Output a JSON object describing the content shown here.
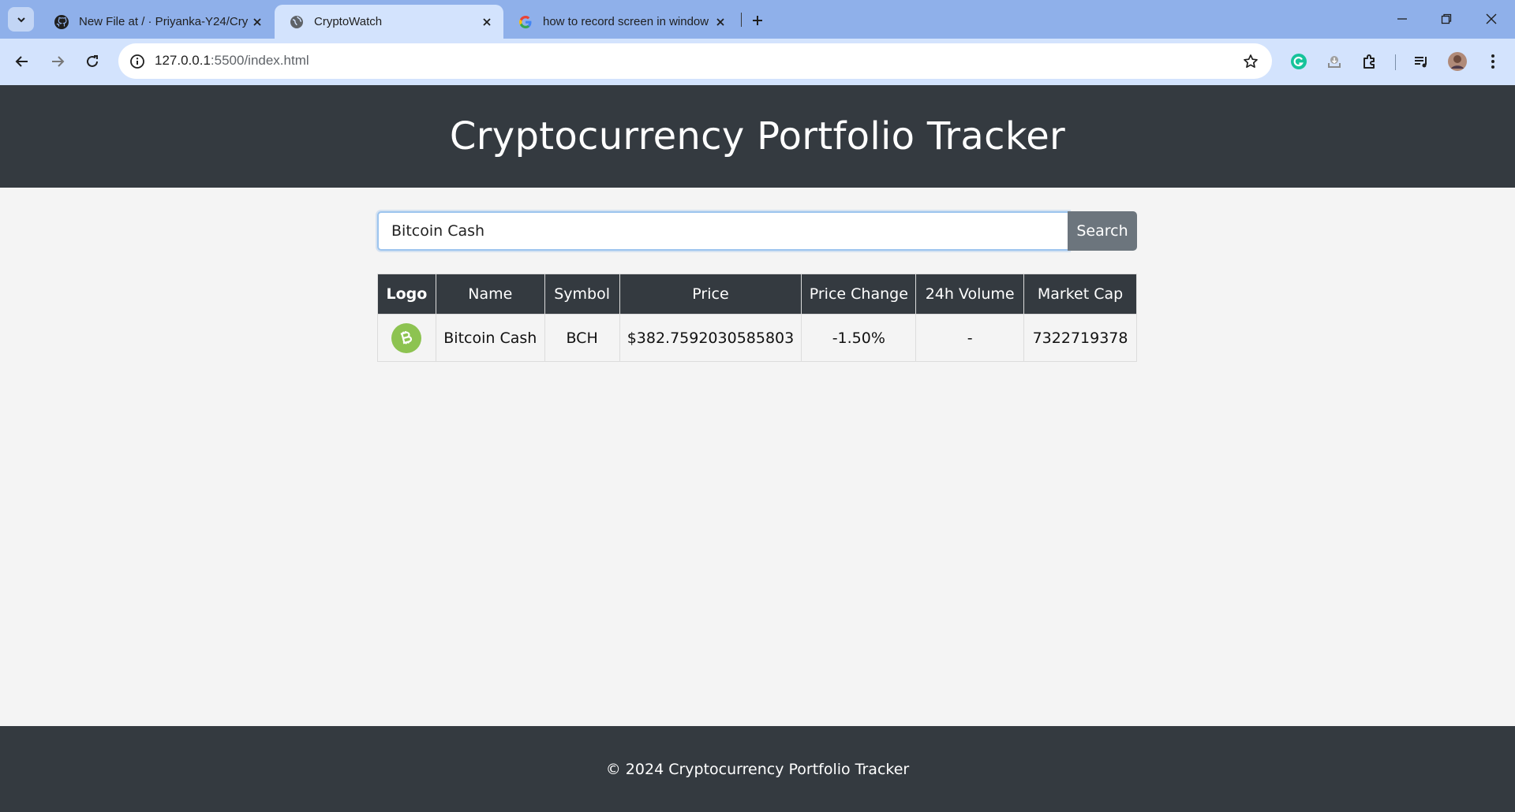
{
  "browser": {
    "tabs": [
      {
        "title": "New File at / · Priyanka-Y24/Cry",
        "favicon": "github-icon",
        "active": false
      },
      {
        "title": "CryptoWatch",
        "favicon": "globe-icon",
        "active": true
      },
      {
        "title": "how to record screen in window",
        "favicon": "google-icon",
        "active": false
      }
    ],
    "url_host": "127.0.0.1",
    "url_rest": ":5500/index.html"
  },
  "page": {
    "title": "Cryptocurrency Portfolio Tracker",
    "search": {
      "value": "Bitcoin Cash",
      "button_label": "Search"
    },
    "table": {
      "headers": [
        "Logo",
        "Name",
        "Symbol",
        "Price",
        "Price Change",
        "24h Volume",
        "Market Cap"
      ],
      "rows": [
        {
          "logo": "bitcoin-cash-logo",
          "name": "Bitcoin Cash",
          "symbol": "BCH",
          "price": "$382.7592030585803",
          "price_change": "-1.50%",
          "volume_24h": "-",
          "market_cap": "7322719378"
        }
      ]
    },
    "footer": "© 2024 Cryptocurrency Portfolio Tracker"
  },
  "colors": {
    "header_bg": "#343a40",
    "page_bg": "#f4f4f4",
    "search_button": "#6c757d",
    "coin_logo": "#8dc351",
    "tabstrip": "#8fb0ea",
    "toolbar": "#d3e3fd"
  }
}
